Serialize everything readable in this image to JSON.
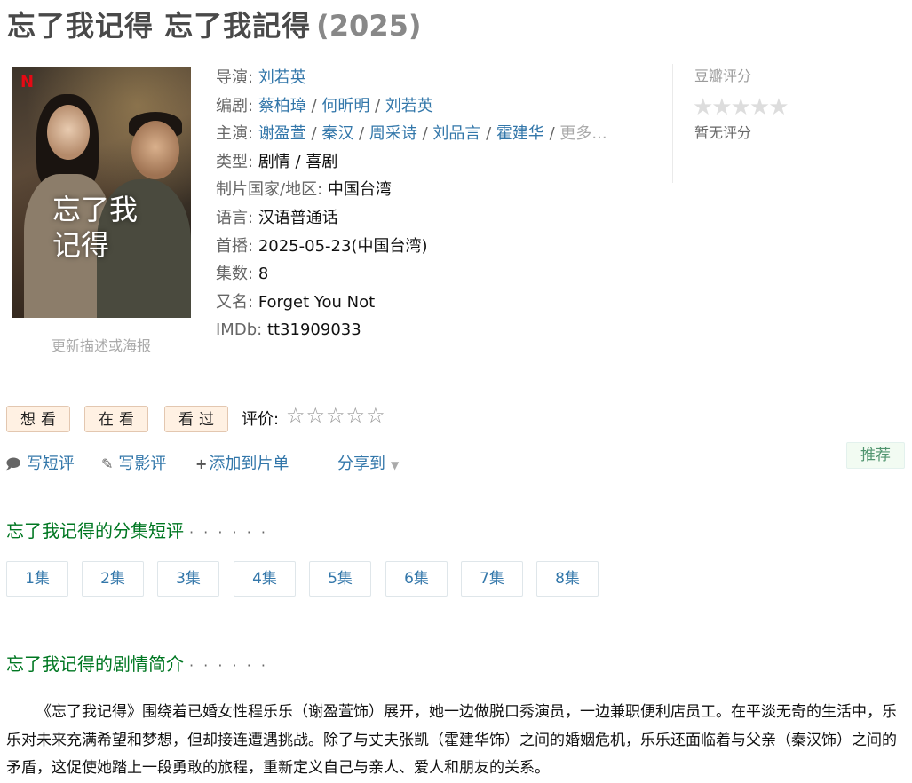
{
  "title": {
    "name": "忘了我记得 忘了我記得",
    "year": "(2025)"
  },
  "poster": {
    "logo": "N",
    "overlay_line1": "忘了我",
    "overlay_line2": "记得",
    "update_link": "更新描述或海报"
  },
  "info": {
    "director_label": "导演:",
    "director": "刘若英",
    "writer_label": "编剧:",
    "writers": [
      "蔡柏璋",
      "何昕明",
      "刘若英"
    ],
    "cast_label": "主演:",
    "cast": [
      "谢盈萱",
      "秦汉",
      "周采诗",
      "刘品言",
      "霍建华"
    ],
    "cast_more": "更多...",
    "genre_label": "类型:",
    "genre": "剧情 / 喜剧",
    "region_label": "制片国家/地区:",
    "region": "中国台湾",
    "language_label": "语言:",
    "language": "汉语普通话",
    "premiere_label": "首播:",
    "premiere": "2025-05-23(中国台湾)",
    "episodes_label": "集数:",
    "episodes": "8",
    "aka_label": "又名:",
    "aka": "Forget You Not",
    "imdb_label": "IMDb:",
    "imdb": "tt31909033"
  },
  "rating": {
    "title": "豆瓣评分",
    "stars": "★★★★★",
    "none_text": "暂无评分"
  },
  "actions": {
    "want": "想看",
    "watching": "在看",
    "watched": "看过",
    "rate_label": "评价:",
    "rate_stars": "☆☆☆☆☆",
    "short_review": "写短评",
    "review": "写影评",
    "add_list": "添加到片单",
    "share": "分享到",
    "recommend": "推荐"
  },
  "episode_section": {
    "title": "忘了我记得的分集短评",
    "dots": "· · · · · ·",
    "items": [
      "1集",
      "2集",
      "3集",
      "4集",
      "5集",
      "6集",
      "7集",
      "8集"
    ]
  },
  "summary_section": {
    "title": "忘了我记得的剧情简介",
    "dots": "· · · · · ·",
    "text": "《忘了我记得》围绕着已婚女性程乐乐（谢盈萱饰）展开，她一边做脱口秀演员，一边兼职便利店员工。在平淡无奇的生活中，乐乐对未来充满希望和梦想，但却接连遭遇挑战。除了与丈夫张凯（霍建华饰）之间的婚姻危机，乐乐还面临着与父亲（秦汉饰）之间的矛盾，这促使她踏上一段勇敢的旅程，重新定义自己与亲人、爱人和朋友的关系。"
  }
}
